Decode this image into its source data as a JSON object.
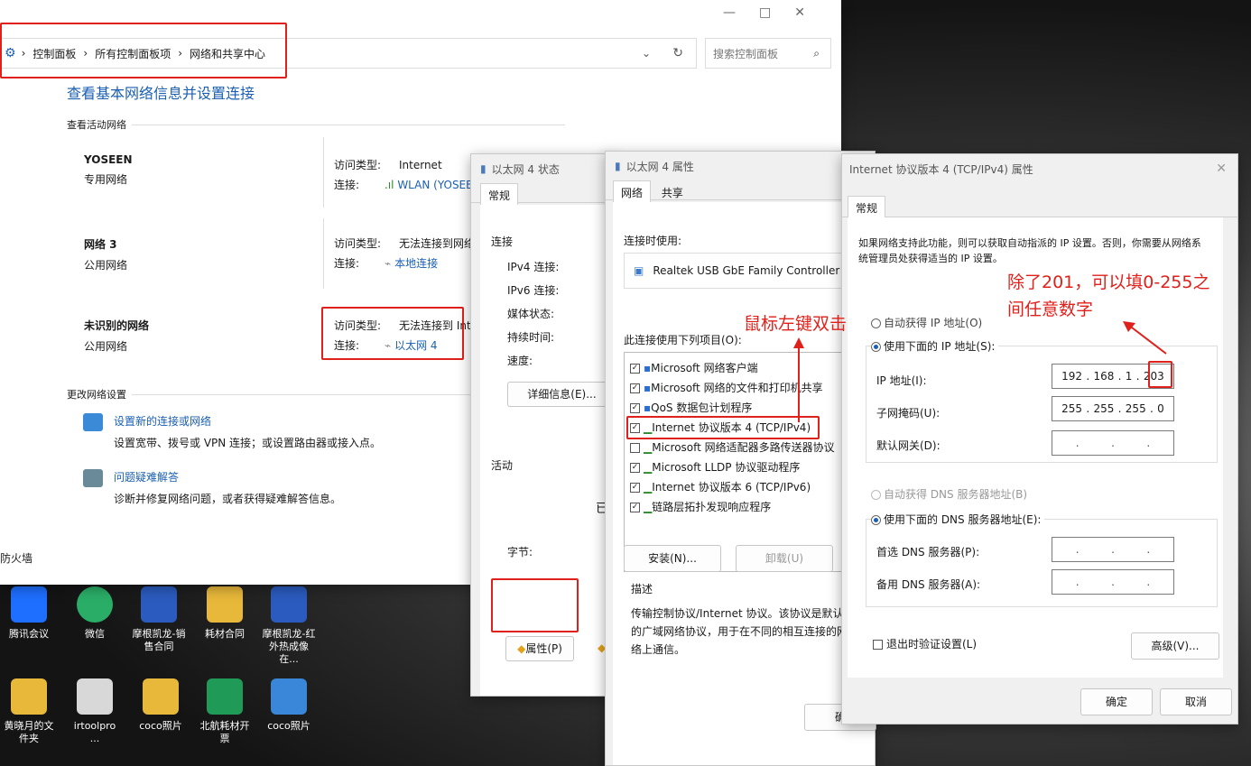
{
  "main": {
    "breadcrumb": [
      "控制面板",
      "所有控制面板项",
      "网络和共享中心"
    ],
    "search_placeholder": "搜索控制面板",
    "heading": "查看基本网络信息并设置连接",
    "active_section": "查看活动网络",
    "networks": [
      {
        "name": "YOSEEN",
        "type": "专用网络",
        "access_label": "访问类型:",
        "access": "Internet",
        "conn_label": "连接:",
        "conn": "WLAN (YOSEEN"
      },
      {
        "name": "网络 3",
        "type": "公用网络",
        "access_label": "访问类型:",
        "access": "无法连接到网络",
        "conn_label": "连接:",
        "conn": "本地连接"
      },
      {
        "name": "未识别的网络",
        "type": "公用网络",
        "access_label": "访问类型:",
        "access": "无法连接到 Inte",
        "conn_label": "连接:",
        "conn": "以太网 4"
      }
    ],
    "change_section": "更改网络设置",
    "tasks": [
      {
        "title": "设置新的连接或网络",
        "desc": "设置宽带、拨号或 VPN 连接；或设置路由器或接入点。"
      },
      {
        "title": "问题疑难解答",
        "desc": "诊断并修复网络问题，或者获得疑难解答信息。"
      }
    ],
    "side_link": "防火墙"
  },
  "status_dialog": {
    "title": "以太网 4 状态",
    "tab": "常规",
    "conn_section": "连接",
    "rows": [
      "IPv4 连接:",
      "IPv6 连接:",
      "媒体状态:",
      "持续时间:",
      "速度:"
    ],
    "details_button": "详细信息(E)...",
    "activity_section": "活动",
    "bytes_label": "字节:",
    "partial_text": "已",
    "properties_button": "属性(P)"
  },
  "props_dialog": {
    "title": "以太网 4 属性",
    "tabs": [
      "网络",
      "共享"
    ],
    "connect_using": "连接时使用:",
    "adapter": "Realtek USB GbE Family Controller",
    "items_label": "此连接使用下列项目(O):",
    "items": [
      {
        "label": "Microsoft 网络客户端",
        "checked": "✓"
      },
      {
        "label": "Microsoft 网络的文件和打印机共享",
        "checked": "✓"
      },
      {
        "label": "QoS 数据包计划程序",
        "checked": "✓"
      },
      {
        "label": "Internet 协议版本 4 (TCP/IPv4)",
        "checked": "✓"
      },
      {
        "label": "Microsoft 网络适配器多路传送器协议",
        "checked": ""
      },
      {
        "label": "Microsoft LLDP 协议驱动程序",
        "checked": "✓"
      },
      {
        "label": "Internet 协议版本 6 (TCP/IPv6)",
        "checked": "✓"
      },
      {
        "label": "链路层拓扑发现响应程序",
        "checked": "✓"
      }
    ],
    "install_button": "安装(N)...",
    "uninstall_button": "卸载(U)",
    "desc_label": "描述",
    "desc_text": "传输控制协议/Internet 协议。该协议是默认的广域网络协议，用于在不同的相互连接的网络上通信。",
    "ok_partial": "确"
  },
  "ipv4_dialog": {
    "title": "Internet 协议版本 4 (TCP/IPv4) 属性",
    "tab": "常规",
    "intro": "如果网络支持此功能，则可以获取自动指派的 IP 设置。否则，你需要从网络系统管理员处获得适当的 IP 设置。",
    "auto_ip": "自动获得 IP 地址(O)",
    "manual_ip": "使用下面的 IP 地址(S):",
    "ip_label": "IP 地址(I):",
    "ip": [
      "192",
      "168",
      "1",
      "203"
    ],
    "mask_label": "子网掩码(U):",
    "mask": [
      "255",
      "255",
      "255",
      "0"
    ],
    "gw_label": "默认网关(D):",
    "auto_dns": "自动获得 DNS 服务器地址(B)",
    "manual_dns": "使用下面的 DNS 服务器地址(E):",
    "dns1_label": "首选 DNS 服务器(P):",
    "dns2_label": "备用 DNS 服务器(A):",
    "validate": "退出时验证设置(L)",
    "advanced_button": "高级(V)...",
    "ok_button": "确定",
    "cancel_button": "取消"
  },
  "annotations": {
    "double_click": "鼠标左键双击",
    "hint_line1": "除了201，可以填0-255之",
    "hint_line2": "间任意数字"
  },
  "desktop": [
    {
      "label": "腾讯会议"
    },
    {
      "label": "微信"
    },
    {
      "label": "摩根凯龙-销售合同"
    },
    {
      "label": "耗材合同"
    },
    {
      "label": "摩根凯龙-红外热成像在..."
    },
    {
      "label": "黄晓月的文件夹"
    },
    {
      "label": "irtoolpro ..."
    },
    {
      "label": "coco照片"
    },
    {
      "label": "北航耗材开票"
    },
    {
      "label": "coco照片"
    }
  ]
}
